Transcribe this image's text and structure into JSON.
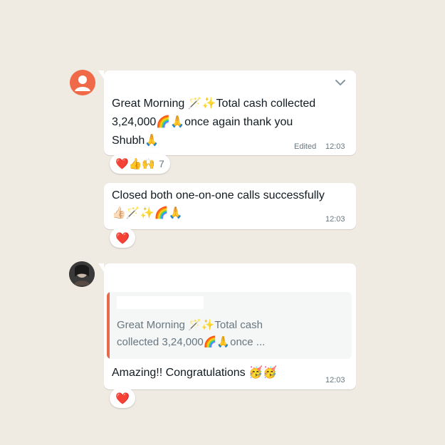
{
  "messages": [
    {
      "text_lines": [
        "Great Morning 🪄✨Total cash collected",
        "3,24,000🌈🙏once again thank you",
        "Shubh🙏"
      ],
      "edited_label": "Edited",
      "time": "12:03",
      "reaction_emojis": "❤️👍🙌",
      "reaction_count": "7"
    },
    {
      "text_lines": [
        "Closed both one-on-one calls successfully",
        "👍🏻🪄✨🌈🙏"
      ],
      "time": "12:03",
      "reaction_emojis": "❤️"
    },
    {
      "quote_lines": [
        "Great Morning 🪄✨Total cash",
        "collected 3,24,000🌈🙏once ..."
      ],
      "text": "Amazing!! Congratulations 🥳🥳",
      "time": "12:03",
      "reaction_emojis": "❤️"
    }
  ],
  "colors": {
    "background": "#efeae2",
    "bubble": "#ffffff",
    "quote_bar": "#e8694b",
    "heart": "#e11d48",
    "avatar_default": "#f06a4a"
  },
  "icons": [
    "default-avatar-icon",
    "chevron-down-icon",
    "contact-avatar-icon"
  ]
}
